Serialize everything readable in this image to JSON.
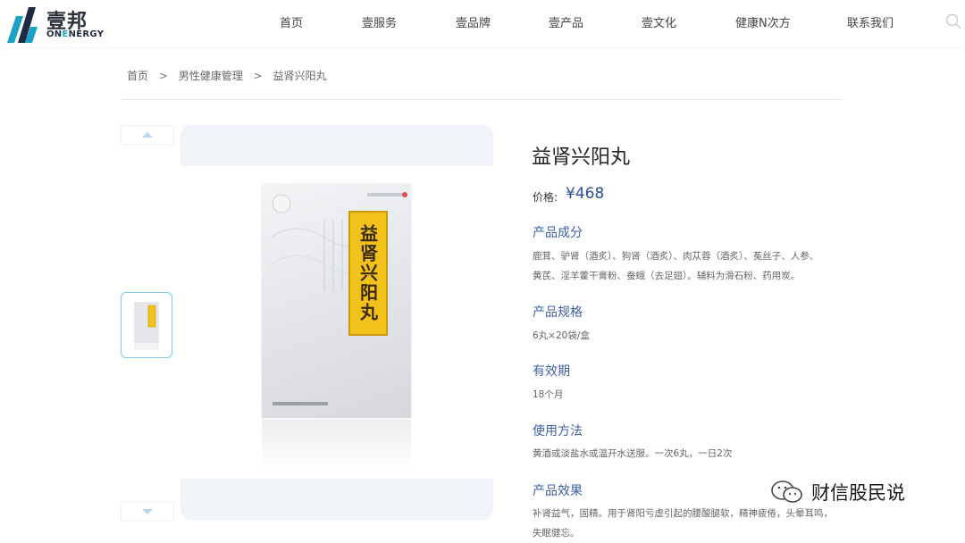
{
  "brand": {
    "cn": "壹邦",
    "en_prefix": "ON",
    "en_highlight": "E",
    "en_suffix": "NERGY"
  },
  "nav": [
    "首页",
    "壹服务",
    "壹品牌",
    "壹产品",
    "壹文化",
    "健康N次方",
    "联系我们"
  ],
  "breadcrumb": [
    "首页",
    "男性健康管理",
    "益肾兴阳丸"
  ],
  "breadcrumb_sep": ">",
  "product": {
    "image_label": "益肾兴阳丸",
    "title": "益肾兴阳丸",
    "price_label": "价格:",
    "price": "¥468"
  },
  "sections": [
    {
      "heading": "产品成分",
      "lines": [
        "鹿茸、驴肾（酒炙）、狗肾（酒炙）、肉苁蓉（酒炙）、菟丝子、人参、",
        "黄芪、淫羊藿干膏粉、蚕蛾（去足翅）。辅料为滑石粉、药用炭。"
      ]
    },
    {
      "heading": "产品规格",
      "lines": [
        "6丸×20袋/盒"
      ]
    },
    {
      "heading": "有效期",
      "lines": [
        "18个月"
      ]
    },
    {
      "heading": "使用方法",
      "lines": [
        "黄酒或淡盐水或温开水送服。一次6丸，一日2次"
      ]
    },
    {
      "heading": "产品效果",
      "lines": [
        "补肾益气，固精。用于肾阳亏虚引起的腰酸腿软，精神疲倦，头晕耳鸣，",
        "失眠健忘。"
      ]
    }
  ],
  "watermark": "财信股民说",
  "colors": {
    "accent": "#3d5fa8",
    "logo_teal": "#1aa2c6",
    "label_yellow": "#f2c21b"
  }
}
